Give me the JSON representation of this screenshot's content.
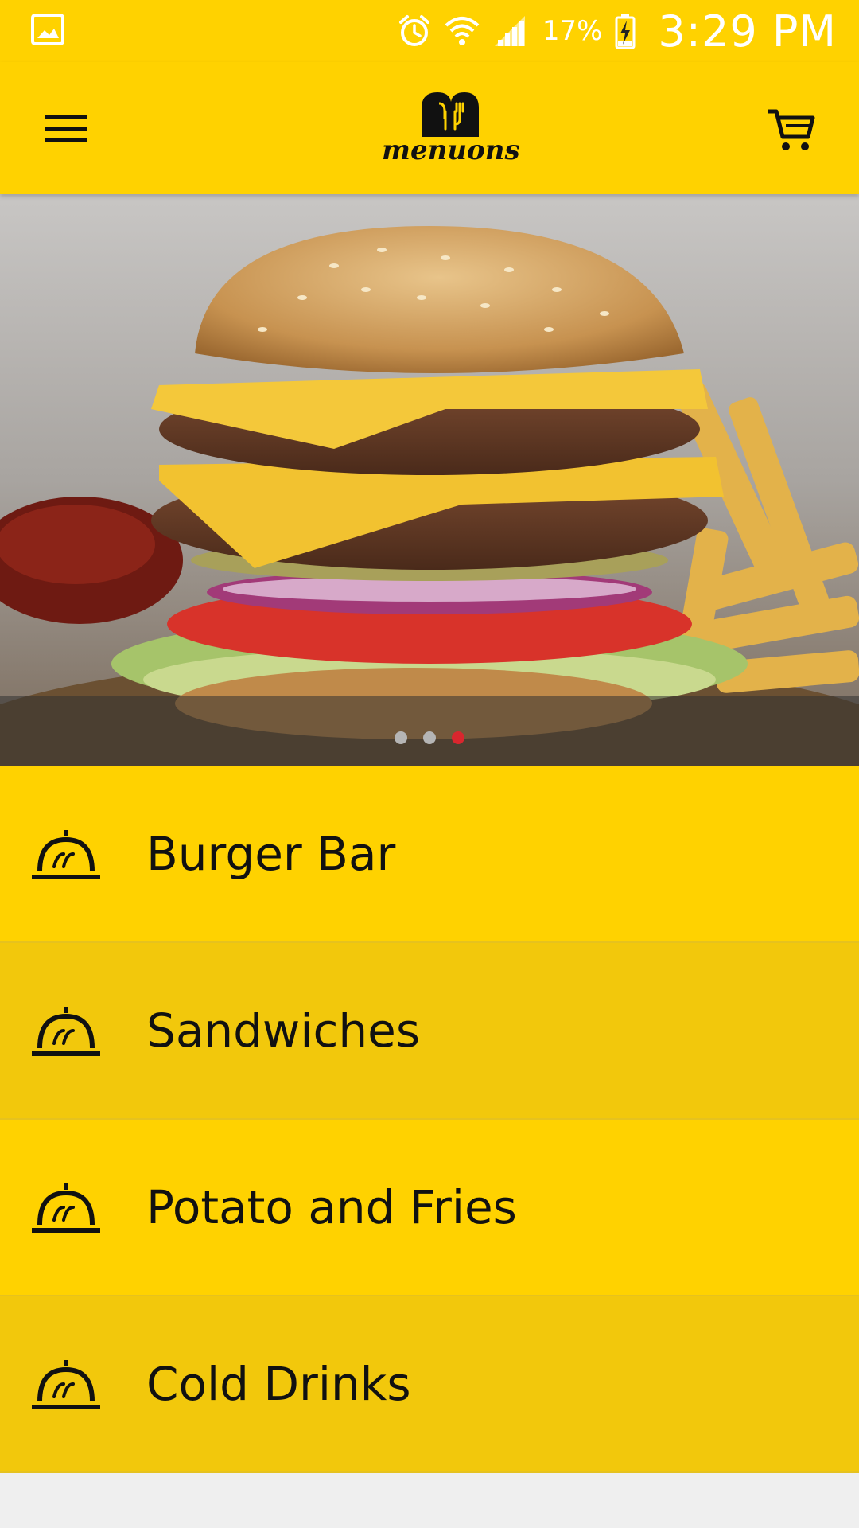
{
  "status_bar": {
    "battery": "17%",
    "time": "3:29 PM",
    "icons": [
      "gallery-icon",
      "alarm-icon",
      "wifi-icon",
      "signal-icon",
      "battery-charging-icon"
    ]
  },
  "app_bar": {
    "logo_text": "menuons",
    "menu_icon": "hamburger-menu-icon",
    "cart_icon": "cart-icon"
  },
  "carousel": {
    "slide_count": 3,
    "active_index": 2
  },
  "categories": [
    {
      "label": "Burger Bar",
      "icon": "food-cloche-icon"
    },
    {
      "label": "Sandwiches",
      "icon": "food-cloche-icon"
    },
    {
      "label": "Potato and Fries",
      "icon": "food-cloche-icon"
    },
    {
      "label": "Cold Drinks",
      "icon": "food-cloche-icon"
    }
  ],
  "colors": {
    "brand_yellow": "#ffd200",
    "row_alt": "#f2c80c",
    "active_dot": "#d9262e"
  }
}
